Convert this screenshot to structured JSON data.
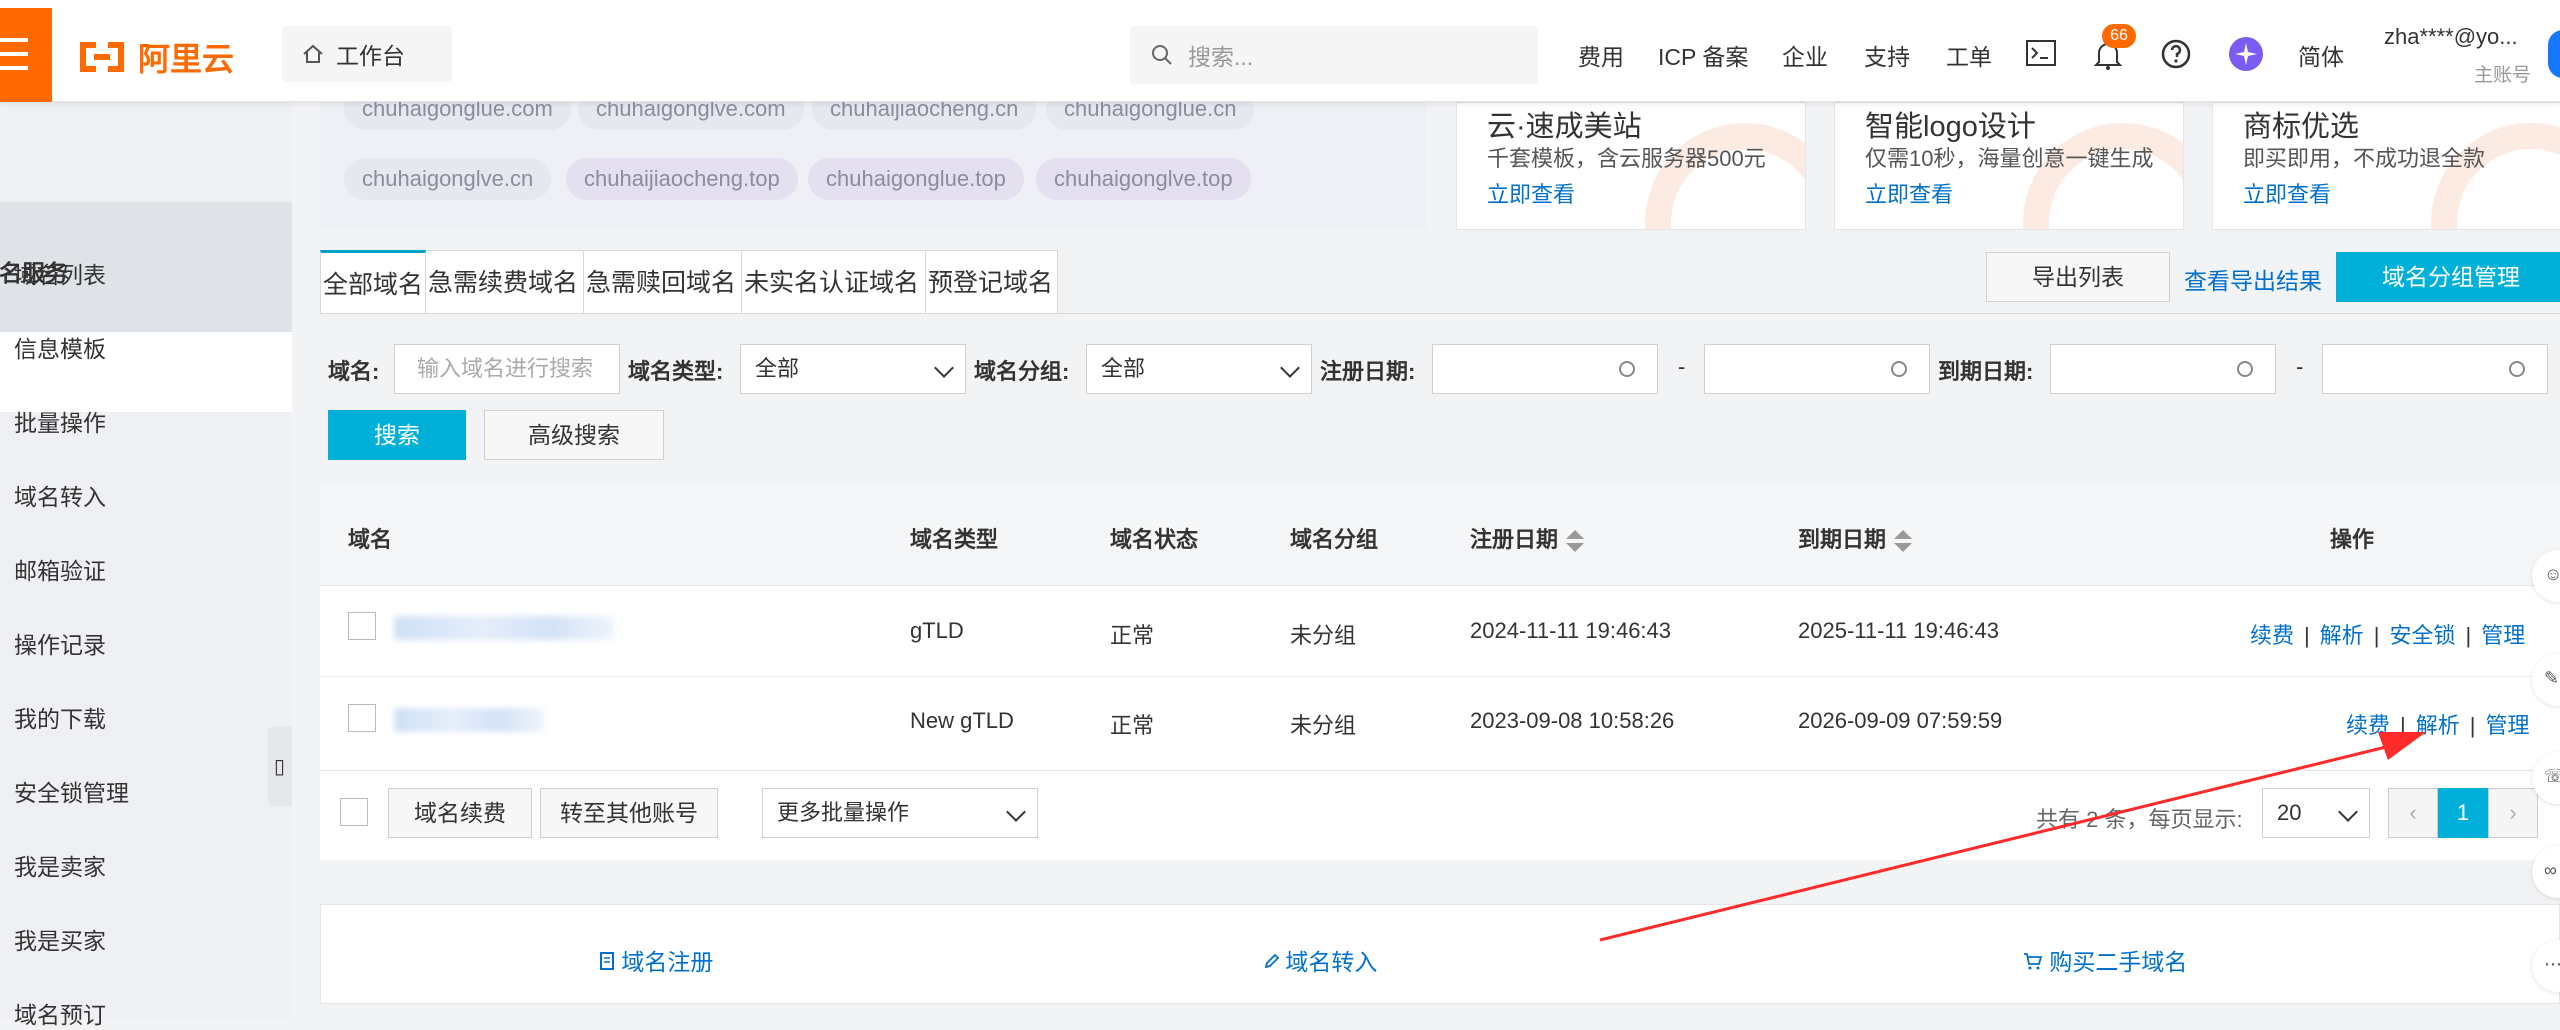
{
  "topbar": {
    "logo_text": "阿里云",
    "workbench": "工作台",
    "search_placeholder": "搜索...",
    "nav": [
      "费用",
      "ICP 备案",
      "企业",
      "支持",
      "工单",
      "简体"
    ],
    "notification_count": "66",
    "user_name": "zha****@yo...",
    "user_role": "主账号"
  },
  "sidebar": {
    "section_title": "域名服务",
    "items": [
      "域名列表",
      "信息模板",
      "批量操作",
      "域名转入",
      "邮箱验证",
      "操作记录",
      "我的下载",
      "安全锁管理",
      "我是卖家",
      "我是买家",
      "域名预订"
    ]
  },
  "suggest_domains": {
    "row1": [
      "chuhaigonglue.com",
      "chuhaigonglve.com",
      "chuhaijiaocheng.cn",
      "chuhaigonglue.cn"
    ],
    "row2": [
      "chuhaigonglve.cn",
      "chuhaijiaocheng.top",
      "chuhaigonglue.top",
      "chuhaigonglve.top"
    ]
  },
  "promos": [
    {
      "title": "云·速成美站",
      "desc": "千套模板，含云服务器500元",
      "link": "立即查看"
    },
    {
      "title": "智能logo设计",
      "desc": "仅需10秒，海量创意一键生成",
      "link": "立即查看"
    },
    {
      "title": "商标优选",
      "desc": "即买即用，不成功退全款",
      "link": "立即查看"
    }
  ],
  "tabs": [
    "全部域名",
    "急需续费域名",
    "急需赎回域名",
    "未实名认证域名",
    "预登记域名"
  ],
  "toolbar": {
    "export_list": "导出列表",
    "view_export": "查看导出结果",
    "group_manage": "域名分组管理"
  },
  "filters": {
    "domain_label": "域名:",
    "domain_placeholder": "输入域名进行搜索",
    "type_label": "域名类型:",
    "type_value": "全部",
    "group_label": "域名分组:",
    "group_value": "全部",
    "reg_date_label": "注册日期:",
    "exp_date_label": "到期日期:",
    "dash": "-",
    "search_btn": "搜索",
    "advanced_btn": "高级搜索"
  },
  "table": {
    "headers": [
      "域名",
      "域名类型",
      "域名状态",
      "域名分组",
      "注册日期",
      "到期日期",
      "操作"
    ],
    "rows": [
      {
        "type": "gTLD",
        "status": "正常",
        "group": "未分组",
        "reg": "2024-11-11 19:46:43",
        "exp": "2025-11-11 19:46:43",
        "ops": [
          "续费",
          "解析",
          "安全锁",
          "管理"
        ]
      },
      {
        "type": "New gTLD",
        "status": "正常",
        "group": "未分组",
        "reg": "2023-09-08 10:58:26",
        "exp": "2026-09-09 07:59:59",
        "ops": [
          "续费",
          "解析",
          "管理"
        ]
      }
    ],
    "separator": "|"
  },
  "footer": {
    "renew_btn": "域名续费",
    "transfer_btn": "转至其他账号",
    "batch_select": "更多批量操作",
    "pager_text": "共有 2 条，每页显示:",
    "page_size": "20",
    "current_page": "1",
    "prev": "‹",
    "next": "›"
  },
  "quick_links": [
    "域名注册",
    "域名转入",
    "购买二手域名"
  ],
  "colors": {
    "brand": "#ff6a00",
    "primary": "#00b0d8",
    "link": "#0070cc",
    "annotation_arrow": "#ff2a2a"
  }
}
